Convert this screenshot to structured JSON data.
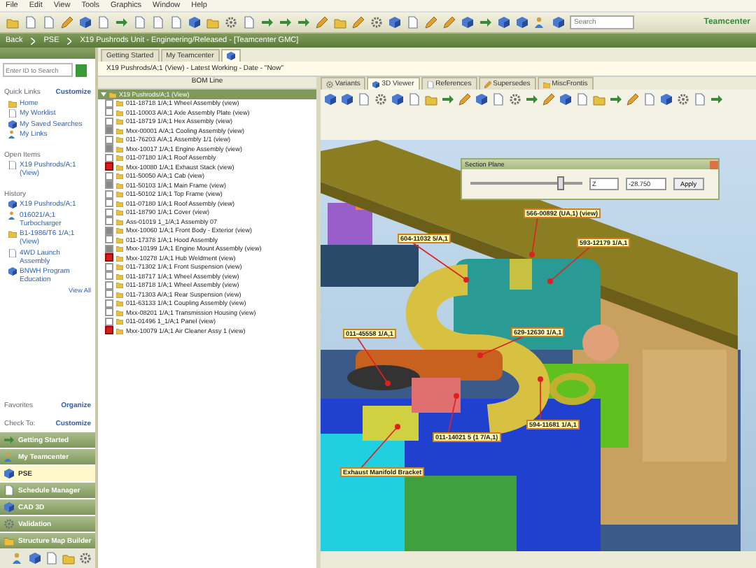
{
  "menu": [
    "File",
    "Edit",
    "View",
    "Tools",
    "Graphics",
    "Window",
    "Help"
  ],
  "toolbar": {
    "search_placeholder": "Search"
  },
  "brand": "Teamcenter",
  "breadcrumb": [
    "Back",
    "PSE",
    "X19 Pushrods Unit - Engineering/Released - [Teamcenter GMC]"
  ],
  "left_panel": {
    "search": {
      "placeholder": "Enter ID to Search"
    },
    "sections": [
      {
        "title": "Quick Links",
        "action": "Customize",
        "items": [
          "Home",
          "My Worklist",
          "My Saved Searches",
          "My Links"
        ]
      },
      {
        "title": "Open Items",
        "items": [
          "X19 Pushrods/A;1 (View)"
        ]
      },
      {
        "title": "History",
        "items": [
          "X19 Pushrods/A;1",
          "016021/A;1 Turbocharger",
          "B1-1986/T6 1/A;1 (View)",
          "4WD Launch Assembly",
          "BNWH Program Education"
        ],
        "more": "View All"
      },
      {
        "title": "Favorites",
        "action": "Organize"
      },
      {
        "title": "Check To:",
        "action": "Customize"
      }
    ],
    "nav": [
      {
        "label": "Getting Started",
        "selected": false
      },
      {
        "label": "My Teamcenter",
        "selected": false
      },
      {
        "label": "PSE",
        "selected": true
      },
      {
        "label": "Schedule Manager",
        "selected": false
      },
      {
        "label": "CAD 3D",
        "selected": false
      },
      {
        "label": "Validation",
        "selected": false
      },
      {
        "label": "Structure Map Builder",
        "selected": false
      }
    ]
  },
  "tabs": [
    {
      "kind": "text",
      "label": "Getting Started",
      "selected": false
    },
    {
      "kind": "text",
      "label": "My Teamcenter",
      "selected": false
    },
    {
      "kind": "icon",
      "selected": true
    }
  ],
  "structure_title": "X19 Pushrods/A;1 (View) - Latest Working - Date - \"Now\"",
  "bom": {
    "header": "BOM Line",
    "root": {
      "text": "X19 Pushrods/A;1 (View)",
      "expanded": true,
      "children": [
        {
          "text": "011-18718 1/A;1 Wheel Assembly (view)",
          "kind": "plain"
        },
        {
          "text": "011-10003 A/A;1 Axle Assembly Plate (view)",
          "kind": "plain"
        },
        {
          "text": "011-18719 1/A;1 Hex Assembly (view)",
          "kind": "plain"
        },
        {
          "text": "Mxx-00001 A/A;1 Cooling Assembly (view)",
          "kind": "grey"
        },
        {
          "text": "011-76203 A/A;1 Assembly 1/1 (view)",
          "kind": "plain"
        },
        {
          "text": "Mxx-10017 1/A;1 Engine Assembly (view)",
          "kind": "grey"
        },
        {
          "text": "011-07180 1/A;1 Roof Assembly",
          "kind": "plain"
        },
        {
          "text": "Mxx-10080 1/A;1 Exhaust Stack (view)",
          "kind": "red"
        },
        {
          "text": "011-50050 A/A;1 Cab (view)",
          "kind": "plain"
        },
        {
          "text": "011-50103 1/A;1 Main Frame (view)",
          "kind": "grey"
        },
        {
          "text": "011-50102 1/A;1 Top Frame (view)",
          "kind": "plain"
        },
        {
          "text": "011-07180 1/A;1 Roof Assembly (view)",
          "kind": "plain"
        },
        {
          "text": "011-18790 1/A;1 Cover (view)",
          "kind": "plain"
        },
        {
          "text": "Ass-01019 1_1/A;1 Assembly 07",
          "kind": "plain"
        },
        {
          "text": "Mxx-10060 1/A;1 Front Body - Exterior (view)",
          "kind": "grey"
        },
        {
          "text": "011-17378 1/A;1 Hood Assembly",
          "kind": "plain"
        },
        {
          "text": "Mxx-10199 1/A;1 Engine Mount Assembly (view)",
          "kind": "grey"
        },
        {
          "text": "Mxx-10278 1/A;1 Hub Weldment (view)",
          "kind": "red"
        },
        {
          "text": "011-71302 1/A;1 Front Suspension (view)",
          "kind": "plain"
        },
        {
          "text": "011-18717 1/A;1 Wheel Assembly (view)",
          "kind": "plain"
        },
        {
          "text": "011-18718 1/A;1 Wheel Assembly (view)",
          "kind": "plain"
        },
        {
          "text": "011-71303 A/A;1 Rear Suspension (view)",
          "kind": "plain"
        },
        {
          "text": "011-63133 1/A;1 Coupling Assembly (view)",
          "kind": "plain"
        },
        {
          "text": "Mxx-08201 1/A;1 Transmission Housing (view)",
          "kind": "plain"
        },
        {
          "text": "011-01496 1_1/A;1 Panel (view)",
          "kind": "plain"
        },
        {
          "text": "Mxx-10079 1/A;1 Air Cleaner Assy 1 (view)",
          "kind": "red"
        }
      ]
    }
  },
  "viewer_tabs": [
    {
      "label": "Variants",
      "selected": false
    },
    {
      "label": "3D Viewer",
      "selected": true
    },
    {
      "label": "References",
      "selected": false
    },
    {
      "label": "Supersedes",
      "selected": false
    },
    {
      "label": "MiscFrontis",
      "selected": false
    }
  ],
  "section_dialog": {
    "title": "Section Plane",
    "level": 0.8,
    "axis": "Z",
    "value": "-28.750",
    "button": "Apply"
  },
  "callouts": [
    "566-00892 (UA,1) (view)",
    "604-11032 5/A,1",
    "593-12179 1/A,1",
    "011-45558 1/A,1",
    "629-12630 1/A,1",
    "594-11681 1/A,1",
    "011-14021 5 (1 7/A,1)",
    "Exhaust Manifold Bracket"
  ]
}
